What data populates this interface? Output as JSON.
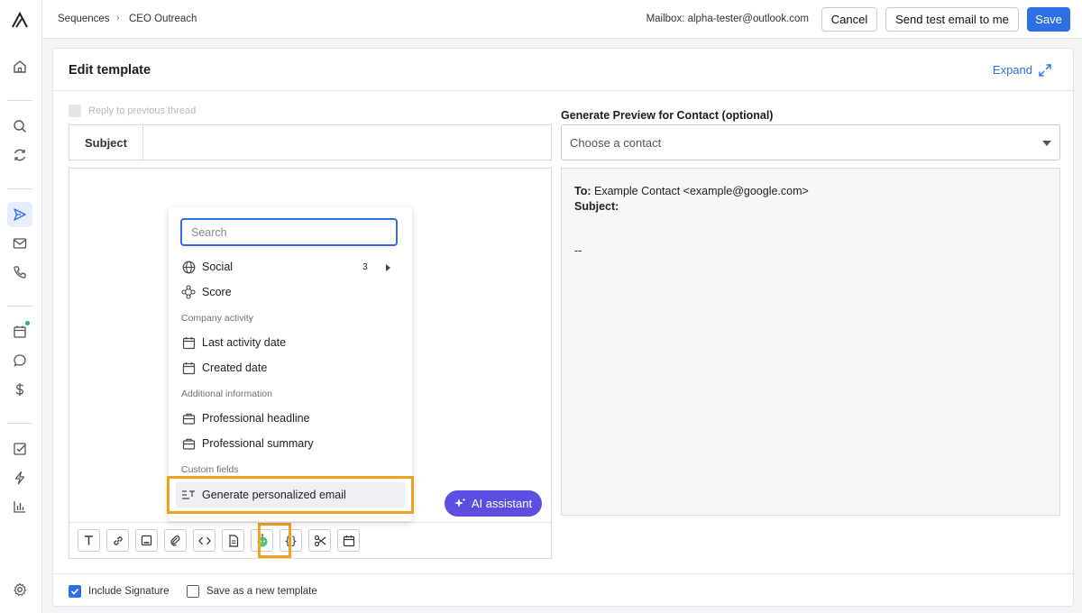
{
  "topbar": {
    "breadcrumb": [
      "Sequences",
      "CEO Outreach"
    ],
    "mailbox": "Mailbox: alpha-tester@outlook.com",
    "cancel_label": "Cancel",
    "test_email_label": "Send test email to me",
    "save_label": "Save"
  },
  "sidenav": {
    "items": [
      "logo-icon",
      "home-icon",
      "search-icon",
      "sync-icon",
      "send-icon",
      "mail-icon",
      "phone-icon",
      "calendar-icon",
      "chat-icon",
      "dollar-icon",
      "checkbox-icon",
      "bolt-icon",
      "bar-chart-icon",
      "gear-icon"
    ],
    "active": "send-icon",
    "notification_dot_color": "#2fb36a"
  },
  "editor": {
    "title": "Edit template",
    "expand_label": "Expand",
    "reply_label": "Reply to previous thread",
    "subject_label": "Subject",
    "subject_value": "",
    "ai_assistant_label": "AI assistant"
  },
  "menu": {
    "search_placeholder": "Search",
    "social_label": "Social",
    "social_count": "3",
    "score_label": "Score",
    "section_company": "Company activity",
    "last_activity_label": "Last activity date",
    "created_date_label": "Created date",
    "section_additional": "Additional information",
    "headline_label": "Professional headline",
    "summary_label": "Professional summary",
    "section_custom": "Custom fields",
    "generate_label": "Generate personalized email",
    "highlight_color": "#f0a121"
  },
  "preview": {
    "label": "Generate Preview for Contact (optional)",
    "select_placeholder": "Choose a contact",
    "to_label": "To:",
    "to_value": "Example Contact <example@google.com>",
    "subject_label": "Subject:",
    "signature_sep": "--"
  },
  "footer": {
    "include_signature_label": "Include Signature",
    "include_signature_checked": true,
    "save_new_template_label": "Save as a new template",
    "save_new_template_checked": false
  },
  "colors": {
    "accent": "#2f6fe4",
    "ai_button": "#5b4ee0"
  }
}
